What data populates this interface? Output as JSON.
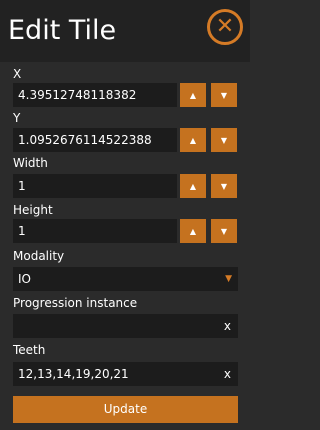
{
  "panel": {
    "title": "Edit Tile",
    "close_label": "✕"
  },
  "fields": {
    "x": {
      "label": "X",
      "value": "4.39512748118382"
    },
    "y": {
      "label": "Y",
      "value": "1.0952676114522388"
    },
    "width": {
      "label": "Width",
      "value": "1"
    },
    "height": {
      "label": "Height",
      "value": "1"
    },
    "modality": {
      "label": "Modality",
      "value": "IO"
    },
    "progression": {
      "label": "Progression instance",
      "value": ""
    },
    "teeth": {
      "label": "Teeth",
      "value": "12,13,14,19,20,21"
    }
  },
  "controls": {
    "increment": "▲",
    "decrement": "▼",
    "dropdown": "▼",
    "clear": "x"
  },
  "update_label": "Update",
  "colors": {
    "accent": "#c5721f",
    "background": "#2b2b2b",
    "header": "#222222",
    "field_bg": "#1c1c1c"
  }
}
